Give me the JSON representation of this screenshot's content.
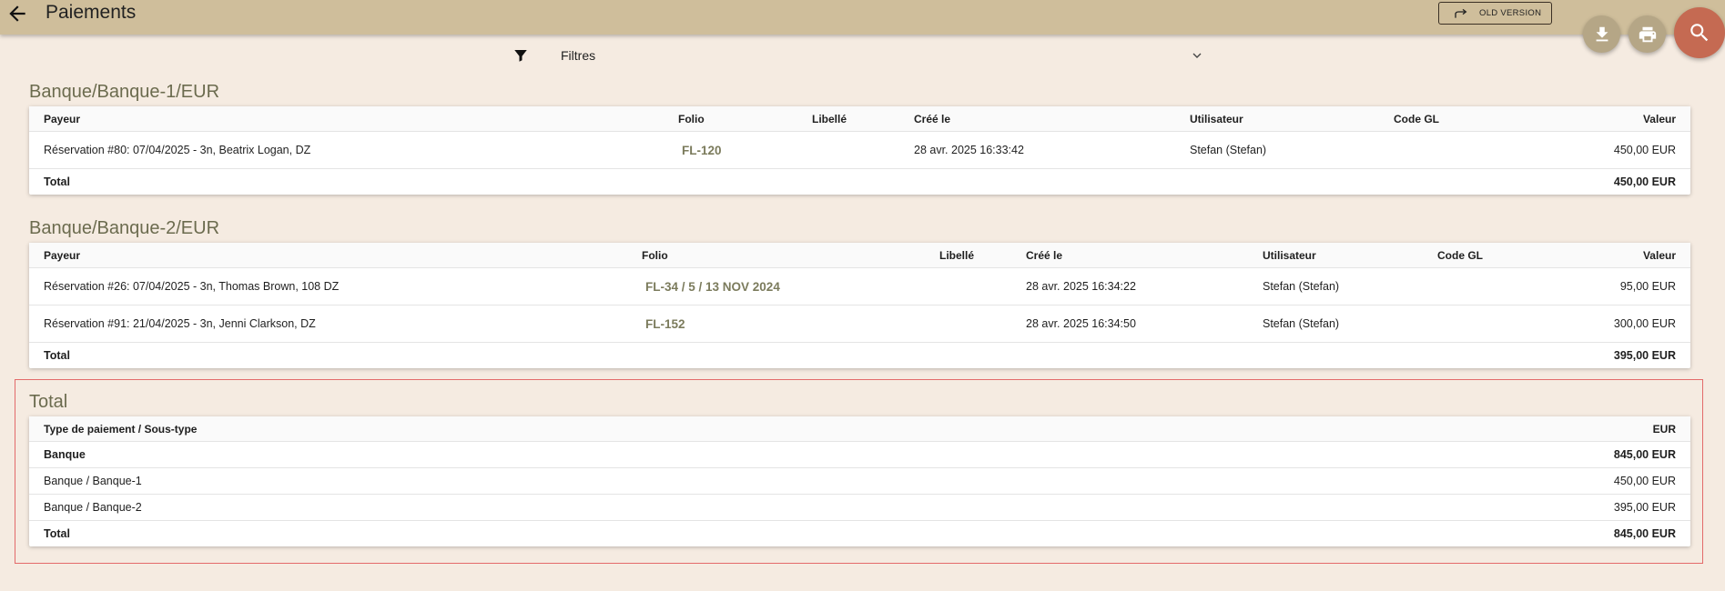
{
  "header": {
    "title": "Paiements",
    "old_version_label": "OLD VERSION"
  },
  "filters": {
    "label": "Filtres"
  },
  "sections": [
    {
      "title": "Banque/Banque-1/EUR",
      "columns": {
        "payeur": "Payeur",
        "folio": "Folio",
        "libelle": "Libellé",
        "cree_le": "Créé le",
        "utilisateur": "Utilisateur",
        "code_gl": "Code GL",
        "valeur": "Valeur"
      },
      "rows": [
        {
          "payeur": "Réservation #80: 07/04/2025 - 3n, Beatrix Logan, DZ",
          "folio": "FL-120",
          "libelle": "",
          "cree_le": "28 avr. 2025 16:33:42",
          "utilisateur": "Stefan (Stefan)",
          "code_gl": "",
          "valeur": "450,00 EUR"
        }
      ],
      "total_label": "Total",
      "total_value": "450,00 EUR"
    },
    {
      "title": "Banque/Banque-2/EUR",
      "columns": {
        "payeur": "Payeur",
        "folio": "Folio",
        "libelle": "Libellé",
        "cree_le": "Créé le",
        "utilisateur": "Utilisateur",
        "code_gl": "Code GL",
        "valeur": "Valeur"
      },
      "rows": [
        {
          "payeur": "Réservation #26: 07/04/2025 - 3n, Thomas Brown, 108 DZ",
          "folio": "FL-34 / 5 / 13 NOV 2024",
          "libelle": "",
          "cree_le": "28 avr. 2025 16:34:22",
          "utilisateur": "Stefan (Stefan)",
          "code_gl": "",
          "valeur": "95,00 EUR"
        },
        {
          "payeur": "Réservation #91: 21/04/2025 - 3n, Jenni Clarkson, DZ",
          "folio": "FL-152",
          "libelle": "",
          "cree_le": "28 avr. 2025 16:34:50",
          "utilisateur": "Stefan (Stefan)",
          "code_gl": "",
          "valeur": "300,00 EUR"
        }
      ],
      "total_label": "Total",
      "total_value": "395,00 EUR"
    }
  ],
  "summary": {
    "title": "Total",
    "col_type": "Type de paiement / Sous-type",
    "col_currency": "EUR",
    "rows": [
      {
        "label": "Banque",
        "value": "845,00 EUR",
        "bold": true
      },
      {
        "label": "Banque / Banque-1",
        "value": "450,00 EUR",
        "bold": false
      },
      {
        "label": "Banque / Banque-2",
        "value": "395,00 EUR",
        "bold": false
      }
    ],
    "total_label": "Total",
    "total_value": "845,00 EUR"
  },
  "colors": {
    "topbar": "#cfbe9b",
    "background": "#f5ebe1",
    "accent_search": "#c56a52",
    "folio_text": "#7b7b5c",
    "highlight_border": "#e36a6a"
  },
  "icons": {
    "back": "arrow-left-icon",
    "old_version": "redo-arrow-icon",
    "download": "download-icon",
    "print": "printer-icon",
    "search": "search-icon",
    "filter": "filter-funnel-icon",
    "chevron": "chevron-down-icon"
  }
}
